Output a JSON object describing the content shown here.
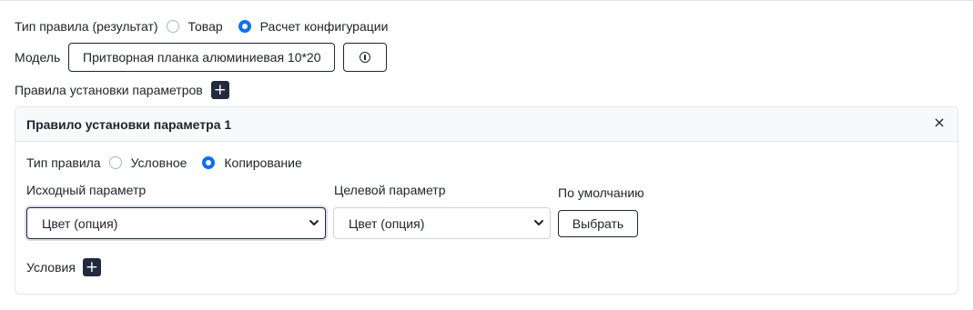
{
  "rule_type_result": {
    "label": "Тип правила (результат)",
    "options": [
      {
        "label": "Товар",
        "checked": false
      },
      {
        "label": "Расчет конфигурации",
        "checked": true
      }
    ]
  },
  "model": {
    "label": "Модель",
    "value": "Притворная планка алюминиевая 10*20",
    "info_icon": "info-circle-icon"
  },
  "param_rules": {
    "label": "Правила установки параметров",
    "add_icon": "plus-icon"
  },
  "rule_card": {
    "title": "Правило установки параметра 1",
    "close_icon": "close-icon",
    "rule_type": {
      "label": "Тип правила",
      "options": [
        {
          "label": "Условное",
          "checked": false
        },
        {
          "label": "Копирование",
          "checked": true
        }
      ]
    },
    "source_param": {
      "label": "Исходный параметр",
      "value": "Цвет (опция)"
    },
    "target_param": {
      "label": "Целевой параметр",
      "value": "Цвет (опция)"
    },
    "default": {
      "label": "По умолчанию",
      "button": "Выбрать"
    },
    "conditions": {
      "label": "Условия",
      "add_icon": "plus-icon"
    }
  },
  "colors": {
    "accent": "#0d6efd",
    "dark_button": "#212a3e",
    "border": "#dee2e6"
  }
}
